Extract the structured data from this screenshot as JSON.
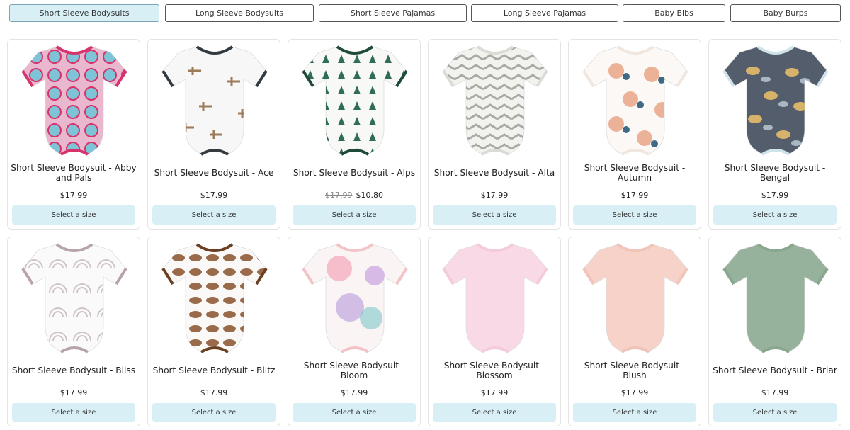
{
  "tabs": [
    {
      "label": "Short Sleeve Bodysuits",
      "active": true
    },
    {
      "label": "Long Sleeve Bodysuits",
      "active": false
    },
    {
      "label": "Short Sleeve Pajamas",
      "active": false
    },
    {
      "label": "Long Sleeve Pajamas",
      "active": false
    },
    {
      "label": "Baby Bibs",
      "active": false
    },
    {
      "label": "Baby Burps",
      "active": false
    }
  ],
  "products": [
    {
      "name": "Short Sleeve Bodysuit - Abby and Pals",
      "price": "$17.99",
      "old_price": "",
      "button": "Select a size",
      "body_color": "#e9b8cf",
      "trim_color": "#d6336c",
      "pattern": "faces",
      "pattern_color": "#7ec3d6"
    },
    {
      "name": "Short Sleeve Bodysuit - Ace",
      "price": "$17.99",
      "old_price": "",
      "button": "Select a size",
      "body_color": "#f7f7f7",
      "trim_color": "#333a40",
      "pattern": "planes",
      "pattern_color": "#9c7b5a"
    },
    {
      "name": "Short Sleeve Bodysuit - Alps",
      "price": "$10.80",
      "old_price": "$17.99",
      "button": "Select a size",
      "body_color": "#f8f8f6",
      "trim_color": "#1f4a3a",
      "pattern": "trees",
      "pattern_color": "#2f6e55"
    },
    {
      "name": "Short Sleeve Bodysuit - Alta",
      "price": "$17.99",
      "old_price": "",
      "button": "Select a size",
      "body_color": "#f2f2ef",
      "trim_color": "#dcdcd6",
      "pattern": "chevron",
      "pattern_color": "#a9aaa3"
    },
    {
      "name": "Short Sleeve Bodysuit - Autumn",
      "price": "$17.99",
      "old_price": "",
      "button": "Select a size",
      "body_color": "#fbf8f5",
      "trim_color": "#f1e6de",
      "pattern": "floral",
      "pattern_color": "#e8a07f"
    },
    {
      "name": "Short Sleeve Bodysuit - Bengal",
      "price": "$17.99",
      "old_price": "",
      "button": "Select a size",
      "body_color": "#545d6b",
      "trim_color": "#cfe3ea",
      "pattern": "animals",
      "pattern_color": "#d6b26b"
    },
    {
      "name": "Short Sleeve Bodysuit - Bliss",
      "price": "$17.99",
      "old_price": "",
      "button": "Select a size",
      "body_color": "#fbfafa",
      "trim_color": "#b7a4a8",
      "pattern": "rainbows",
      "pattern_color": "#cfc4c8"
    },
    {
      "name": "Short Sleeve Bodysuit - Blitz",
      "price": "$17.99",
      "old_price": "",
      "button": "Select a size",
      "body_color": "#fbf9f7",
      "trim_color": "#6b3f22",
      "pattern": "footballs",
      "pattern_color": "#9a6b4a"
    },
    {
      "name": "Short Sleeve Bodysuit - Bloom",
      "price": "$17.99",
      "old_price": "",
      "button": "Select a size",
      "body_color": "#fbf4f5",
      "trim_color": "#f2c4c8",
      "pattern": "watercolor",
      "pattern_color": "#b89ad8"
    },
    {
      "name": "Short Sleeve Bodysuit - Blossom",
      "price": "$17.99",
      "old_price": "",
      "button": "Select a size",
      "body_color": "#f8d9e5",
      "trim_color": "#f4cbdc",
      "pattern": "solid",
      "pattern_color": "#f8d9e5"
    },
    {
      "name": "Short Sleeve Bodysuit - Blush",
      "price": "$17.99",
      "old_price": "",
      "button": "Select a size",
      "body_color": "#f6d2c8",
      "trim_color": "#f0c4b8",
      "pattern": "solid",
      "pattern_color": "#f6d2c8"
    },
    {
      "name": "Short Sleeve Bodysuit - Briar",
      "price": "$17.99",
      "old_price": "",
      "button": "Select a size",
      "body_color": "#97b29c",
      "trim_color": "#89a68f",
      "pattern": "solid",
      "pattern_color": "#97b29c"
    }
  ]
}
